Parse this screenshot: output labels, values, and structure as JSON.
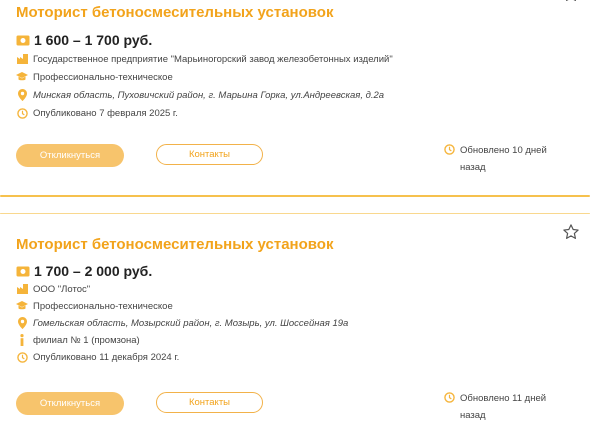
{
  "vacancies": [
    {
      "title": "Моторист бетоносмесительных установок",
      "salary": "1 600 – 1 700 руб.",
      "company": "Государственное предприятие \"Марьиногорский завод железобетонных изделий\"",
      "education": "Профессионально-техническое",
      "location": "Минская область, Пуховичский район, г. Марьина Горка, ул.Андреевская, д.2а",
      "published": "Опубликовано 7 февраля 2025 г.",
      "apply_label": "Откликнуться",
      "contacts_label": "Контакты",
      "updated_line1": "Обновлено 10 дней",
      "updated_line2": "назад"
    },
    {
      "title": "Моторист бетоносмесительных установок",
      "salary": "1 700 – 2 000 руб.",
      "company": "ООО \"Лотос\"",
      "education": "Профессионально-техническое",
      "location": "Гомельская область, Мозырский район, г. Мозырь, ул. Шоссейная 19а",
      "branch": "филиал № 1 (промзона)",
      "published": "Опубликовано 11 декабря 2024 г.",
      "apply_label": "Откликнуться",
      "contacts_label": "Контакты",
      "updated_line1": "Обновлено 11 дней",
      "updated_line2": "назад"
    }
  ],
  "colors": {
    "accent": "#f2a31b",
    "button_fill": "#f7c46c",
    "divider": "#f6c14d",
    "icon": "#f5b43a"
  },
  "icons": [
    "money-icon",
    "building-icon",
    "graduation-cap-icon",
    "location-pin-icon",
    "clock-icon",
    "info-icon",
    "star-icon"
  ]
}
